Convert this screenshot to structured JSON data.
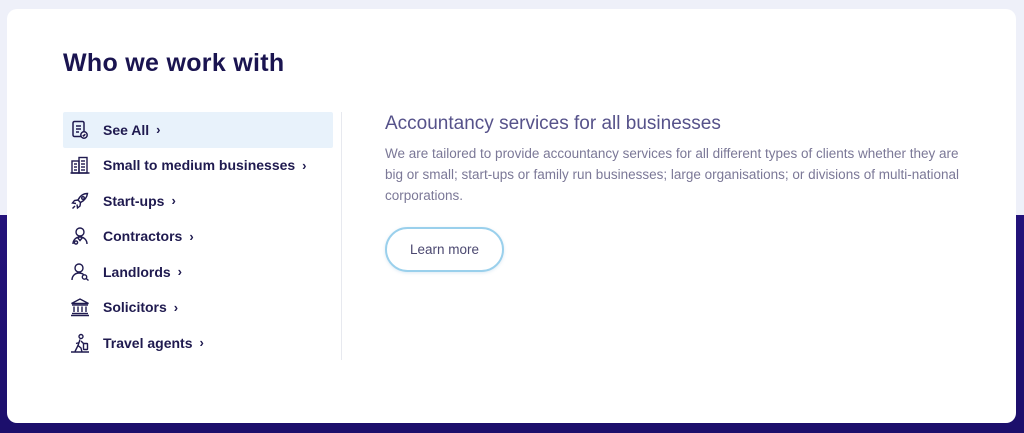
{
  "section": {
    "heading": "Who we work with"
  },
  "menu": {
    "items": [
      {
        "label": "See All",
        "icon": "document-icon"
      },
      {
        "label": "Small to medium businesses",
        "icon": "building-icon"
      },
      {
        "label": "Start-ups",
        "icon": "rocket-icon"
      },
      {
        "label": "Contractors",
        "icon": "person-icon"
      },
      {
        "label": "Landlords",
        "icon": "landlord-icon"
      },
      {
        "label": "Solicitors",
        "icon": "courthouse-icon"
      },
      {
        "label": "Travel agents",
        "icon": "traveller-icon"
      }
    ],
    "chevron": "›",
    "active_index": 0
  },
  "content": {
    "title": "Accountancy services for all businesses",
    "text": "We are tailored to provide accountancy services for all different types of clients whether they are big or small; start-ups or family run businesses; large organisations; or divisions of multi-national corporations.",
    "button_label": "Learn more"
  },
  "colors": {
    "heading": "#1a1450",
    "menu_active_bg": "#e8f2fb",
    "button_border": "#9ad0ec",
    "footer_bg": "#23127a"
  }
}
